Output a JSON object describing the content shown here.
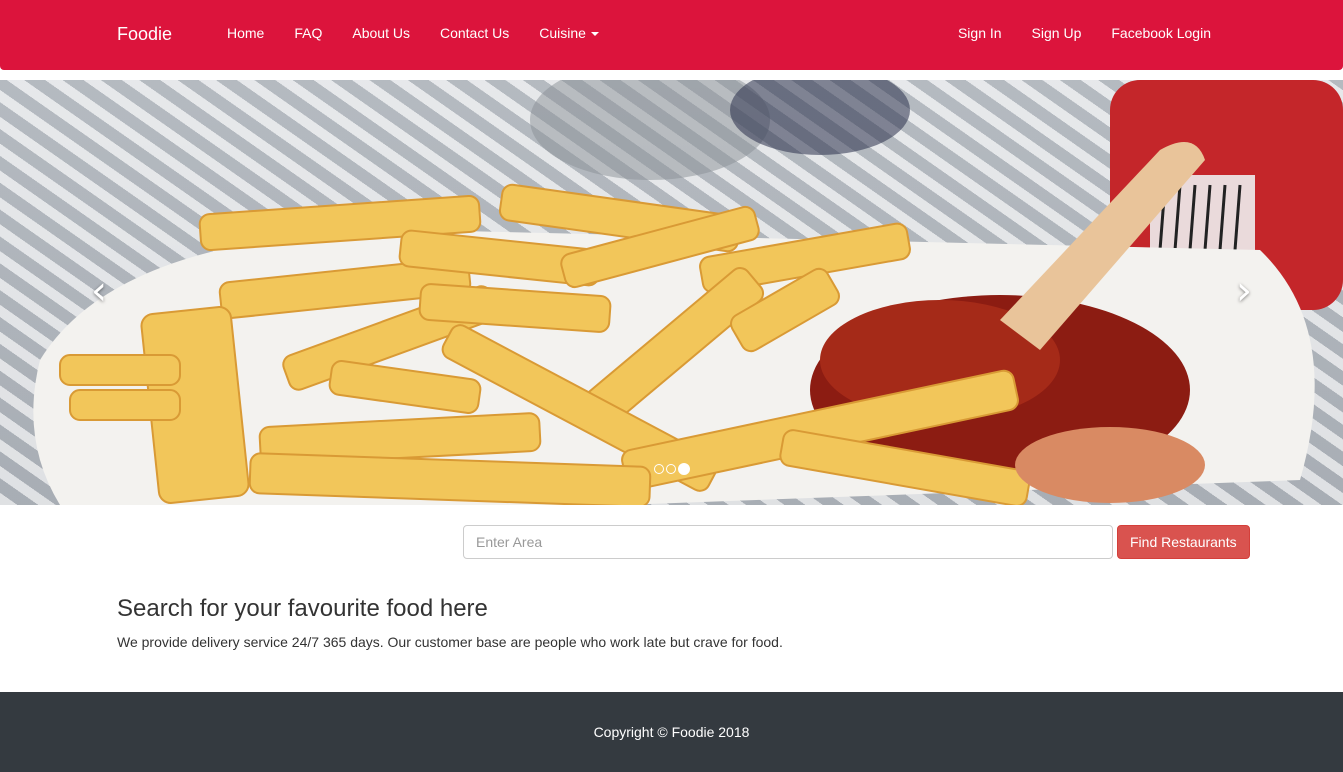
{
  "navbar": {
    "brand": "Foodie",
    "left_links": [
      {
        "label": "Home"
      },
      {
        "label": "FAQ"
      },
      {
        "label": "About Us"
      },
      {
        "label": "Contact Us"
      },
      {
        "label": "Cuisine"
      }
    ],
    "right_links": [
      {
        "label": "Sign In"
      },
      {
        "label": "Sign Up"
      },
      {
        "label": "Facebook Login"
      }
    ]
  },
  "carousel": {
    "image": "fries-with-currywurst",
    "prev_icon": "chevron-left-icon",
    "next_icon": "chevron-right-icon",
    "prev_glyph": "‹",
    "next_glyph": "›",
    "slide_count": 3,
    "active_index": 2
  },
  "search": {
    "placeholder": "Enter Area",
    "value": "",
    "button_label": "Find Restaurants"
  },
  "intro": {
    "heading": "Search for your favourite food here",
    "text": "We provide delivery service 24/7 365 days. Our customer base are people who work late but crave for food."
  },
  "footer": {
    "copyright": "Copyright © Foodie 2018"
  },
  "colors": {
    "navbar": "#dc143c",
    "footer": "#343a40",
    "button": "#d9534f"
  }
}
